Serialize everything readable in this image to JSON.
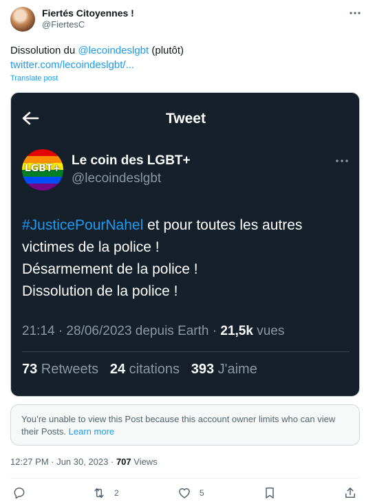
{
  "author": {
    "display_name": "Fiertés Citoyennes !",
    "handle": "@FiertesC"
  },
  "post": {
    "text_prefix": "Dissolution du ",
    "mention": "@lecoindeslgbt",
    "text_suffix": " (plutôt)",
    "link": "twitter.com/lecoindeslgbt/...",
    "translate_label": "Translate post"
  },
  "embedded_card": {
    "header_title": "Tweet",
    "avatar_text": "LGBT+",
    "display_name": "Le coin des LGBT+",
    "handle": "@lecoindeslgbt",
    "hashtag": "#JusticePourNahel",
    "line1_rest": " et pour toutes les autres",
    "line2": "victimes de la police !",
    "line3": "Désarmement de la police !",
    "line4": "Dissolution de la police !",
    "meta_prefix": "21:14 · 28/06/2023 depuis Earth · ",
    "meta_views_count": "21,5k",
    "meta_views_label": " vues",
    "retweets_count": "73",
    "retweets_label": " Retweets",
    "citations_count": "24",
    "citations_label": " citations",
    "likes_count": "393",
    "likes_label": " J'aime"
  },
  "notice": {
    "text": "You’re unable to view this Post because this account owner limits who can view their Posts. ",
    "learn_more": "Learn more"
  },
  "timestamp": {
    "time_date": "12:27 PM · Jun 30, 2023 · ",
    "views_count": "707",
    "views_label": " Views"
  },
  "actions": {
    "retweet_count": "2",
    "like_count": "5"
  },
  "colors": {
    "accent": "#1d9bf0",
    "card_bg": "#15202b",
    "muted": "#536471"
  }
}
